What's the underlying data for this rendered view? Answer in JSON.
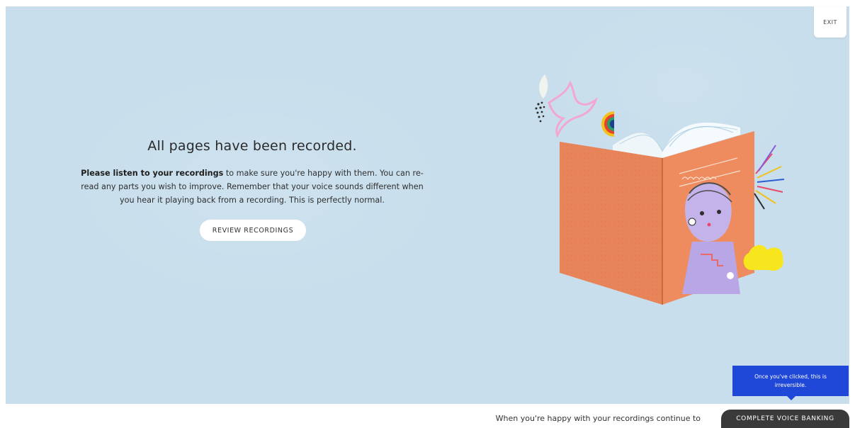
{
  "header": {
    "exit_label": "EXIT"
  },
  "main": {
    "title": "All pages have been recorded.",
    "body_bold": "Please listen to your recordings",
    "body_rest": " to make sure you're happy with them. You can re-read any parts you wish to improve. Remember that your voice sounds different when you hear it playing back from a recording. This is perfectly normal.",
    "review_button_label": "REVIEW RECORDINGS"
  },
  "illustration": {
    "icon": "open-book-portrait-illustration"
  },
  "footer": {
    "prompt_text": "When you're happy with your recordings continue to",
    "complete_button_label": "COMPLETE VOICE BANKING",
    "tooltip_text": "Once you've clicked, this is irreversible."
  },
  "colors": {
    "background": "#c8deec",
    "tooltip": "#1f47d8",
    "complete_button": "#3a3a3a",
    "book_cover": "#e8845a"
  }
}
